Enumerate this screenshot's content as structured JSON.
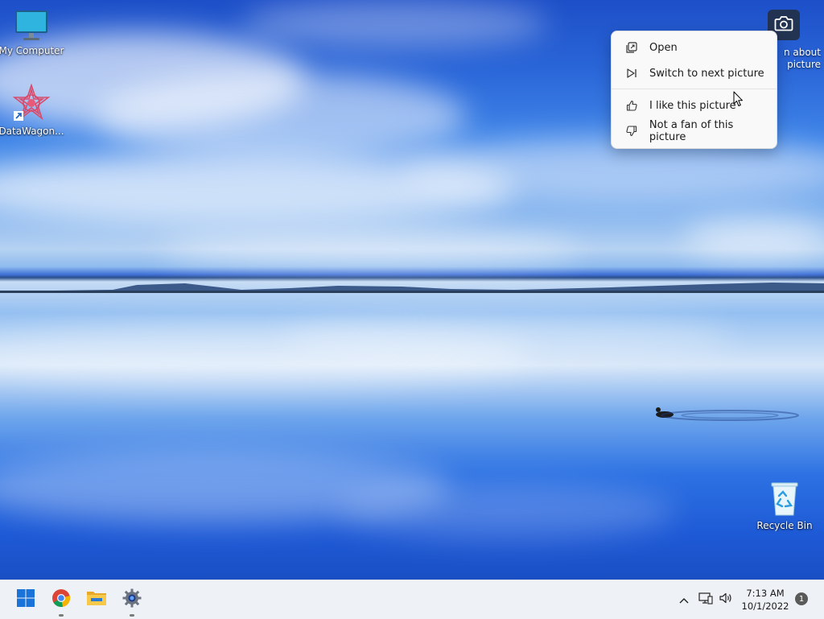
{
  "desktop": {
    "icons": [
      {
        "label": "My Computer",
        "icon": "monitor-icon"
      },
      {
        "label": "DataWagon...",
        "icon": "datawagon-icon"
      },
      {
        "label": "Recycle Bin",
        "icon": "recycle-bin-icon"
      }
    ],
    "spotlight": {
      "icon": "camera-icon",
      "label_line1": "n about",
      "label_line2": "picture"
    }
  },
  "context_menu": {
    "items": [
      {
        "label": "Open",
        "icon": "open-icon"
      },
      {
        "label": "Switch to next picture",
        "icon": "next-picture-icon"
      },
      {
        "label": "I like this picture",
        "icon": "thumbs-up-icon"
      },
      {
        "label": "Not a fan of this picture",
        "icon": "thumbs-down-icon"
      }
    ]
  },
  "taskbar": {
    "apps": [
      {
        "name": "start",
        "icon": "windows-start-icon"
      },
      {
        "name": "chrome",
        "icon": "chrome-icon"
      },
      {
        "name": "file-explorer",
        "icon": "folder-icon"
      },
      {
        "name": "settings",
        "icon": "gear-icon"
      }
    ],
    "tray": {
      "time": "7:13 AM",
      "date": "10/1/2022",
      "notifications": "1"
    }
  }
}
